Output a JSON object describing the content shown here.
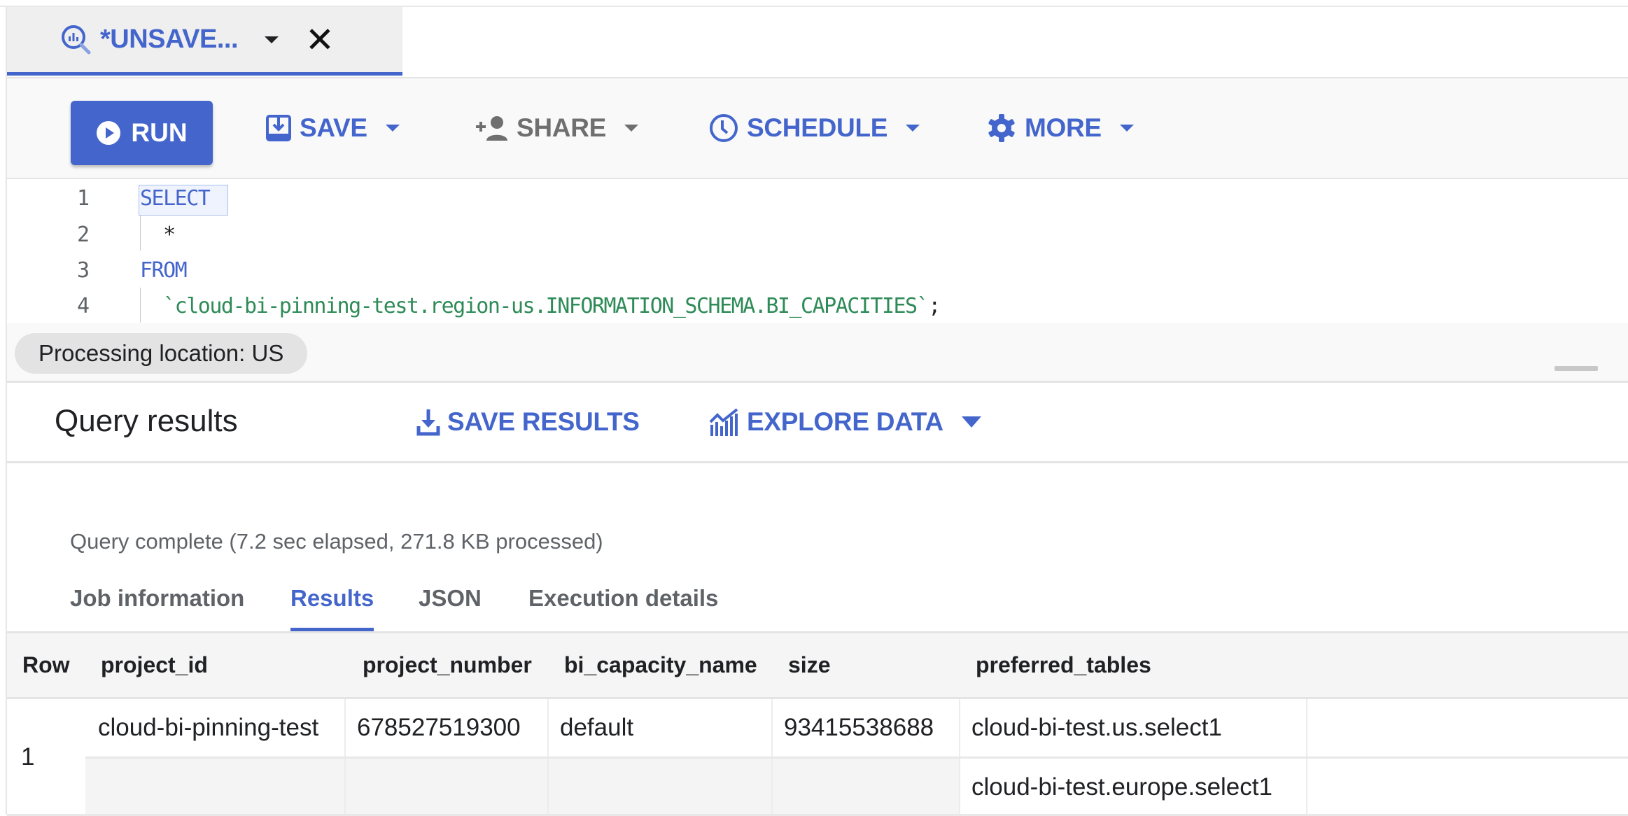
{
  "tab": {
    "icon": "bigquery-query-icon",
    "title": "*UNSAVE...",
    "dropdown_icon": "caret-down-icon",
    "close_icon": "close-icon"
  },
  "toolbar": {
    "run_label": "RUN",
    "save_label": "SAVE",
    "share_label": "SHARE",
    "schedule_label": "SCHEDULE",
    "more_label": "MORE"
  },
  "editor": {
    "lines": [
      {
        "number": "1",
        "text": "SELECT",
        "kind": "keyword"
      },
      {
        "number": "2",
        "text": "  *",
        "kind": "plain"
      },
      {
        "number": "3",
        "text": "FROM",
        "kind": "keyword"
      },
      {
        "number": "4",
        "text": "  `cloud-bi-pinning-test.region-us.INFORMATION_SCHEMA.BI_CAPACITIES`",
        "suffix": ";",
        "kind": "string"
      }
    ]
  },
  "processing": {
    "location_label": "Processing location: US"
  },
  "results": {
    "title": "Query results",
    "save_results_label": "SAVE RESULTS",
    "explore_data_label": "EXPLORE DATA",
    "status": "Query complete (7.2 sec elapsed, 271.8 KB processed)",
    "tabs": [
      {
        "label": "Job information",
        "active": false
      },
      {
        "label": "Results",
        "active": true
      },
      {
        "label": "JSON",
        "active": false
      },
      {
        "label": "Execution details",
        "active": false
      }
    ],
    "table": {
      "columns": [
        "Row",
        "project_id",
        "project_number",
        "bi_capacity_name",
        "size",
        "preferred_tables"
      ],
      "rows": [
        {
          "row": "1",
          "project_id": "cloud-bi-pinning-test",
          "project_number": "678527519300",
          "bi_capacity_name": "default",
          "size": "93415538688",
          "preferred_tables": [
            "cloud-bi-test.us.select1",
            "cloud-bi-test.europe.select1"
          ]
        }
      ]
    }
  },
  "colors": {
    "accent": "#4466cc",
    "string": "#2e8b57",
    "muted": "#5f6368"
  }
}
